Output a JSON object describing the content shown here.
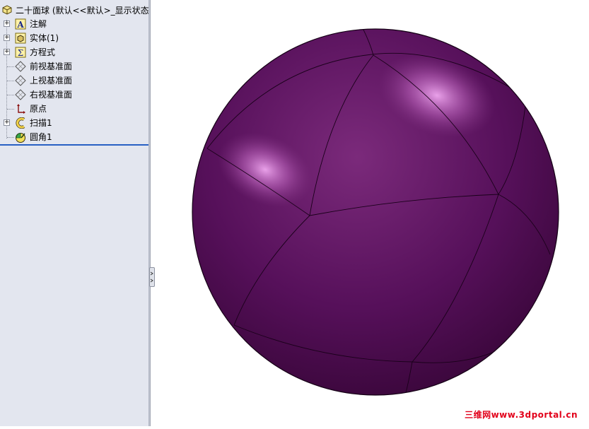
{
  "tree": {
    "root_label": "二十面球 (默认<<默认>_显示状态",
    "items": [
      {
        "label": "注解",
        "icon": "annotation-icon",
        "expandable": true
      },
      {
        "label": "实体(1)",
        "icon": "solid-bodies-icon",
        "expandable": true
      },
      {
        "label": "方程式",
        "icon": "equations-icon",
        "expandable": true
      },
      {
        "label": "前视基准面",
        "icon": "plane-icon",
        "expandable": false
      },
      {
        "label": "上视基准面",
        "icon": "plane-icon",
        "expandable": false
      },
      {
        "label": "右视基准面",
        "icon": "plane-icon",
        "expandable": false
      },
      {
        "label": "原点",
        "icon": "origin-icon",
        "expandable": false
      },
      {
        "label": "扫描1",
        "icon": "sweep-icon",
        "expandable": true
      },
      {
        "label": "圆角1",
        "icon": "fillet-icon",
        "expandable": false
      }
    ]
  },
  "model": {
    "color": "#4e0b4e",
    "highlight": "#e08ee0"
  },
  "watermark": "三维网www.3dportal.cn"
}
